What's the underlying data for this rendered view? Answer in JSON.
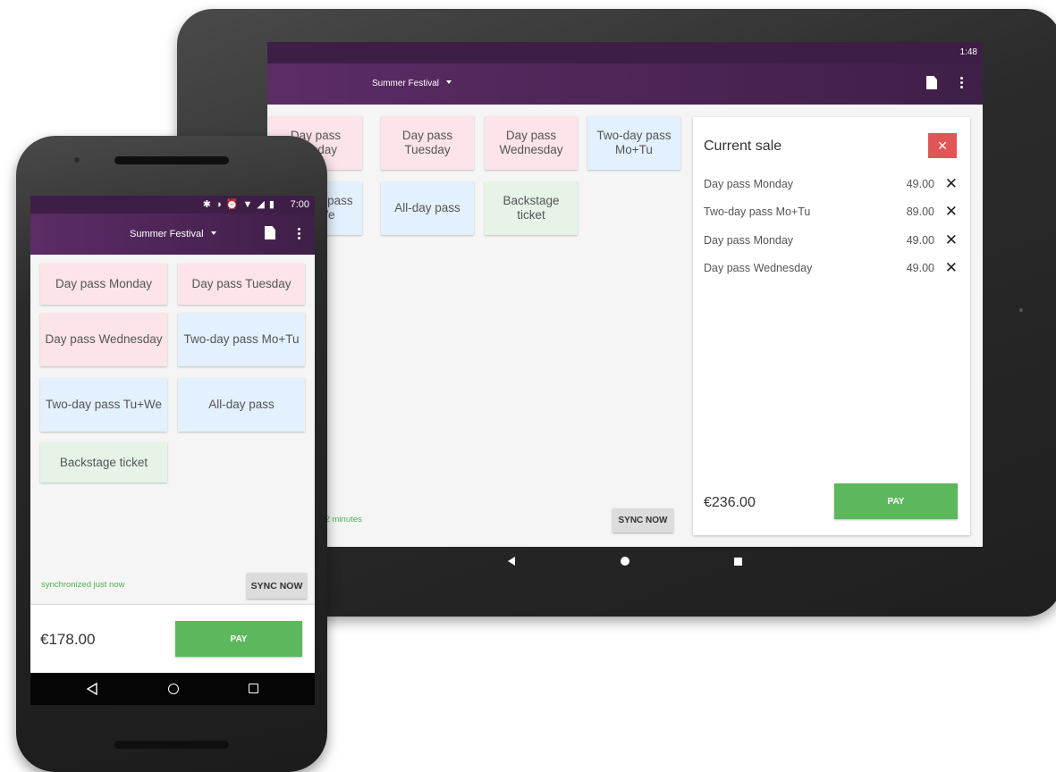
{
  "tablet": {
    "status": {
      "clock": "1:48"
    },
    "appbar": {
      "title": "Summer Festival"
    },
    "tiles": [
      {
        "label": "Day pass Monday",
        "color": "#fce4e8"
      },
      {
        "label": "Day pass Tuesday",
        "color": "#fce4e8"
      },
      {
        "label": "Day pass Wednesday",
        "color": "#fce4e8"
      },
      {
        "label": "Two-day pass Mo+Tu",
        "color": "#e3f0fd"
      },
      {
        "label": "Two-day pass Tu+We",
        "color": "#e3f0fd"
      },
      {
        "label": "All-day pass",
        "color": "#e3f0fd"
      },
      {
        "label": "Backstage ticket",
        "color": "#e6f4e8"
      }
    ],
    "sync_text": "synchronized 2 minutes",
    "sync_button": "SYNC NOW",
    "sale": {
      "title": "Current sale",
      "close_icon": "close-icon",
      "items": [
        {
          "name": "Day pass Monday",
          "price": "49.00"
        },
        {
          "name": "Two-day pass Mo+Tu",
          "price": "89.00"
        },
        {
          "name": "Day pass Monday",
          "price": "49.00"
        },
        {
          "name": "Day pass Wednesday",
          "price": "49.00"
        }
      ],
      "remove_symbol": "✕",
      "total": "€236.00",
      "pay_label": "PAY"
    }
  },
  "phone": {
    "status": {
      "clock": "7:00",
      "icons": "✱ ◑ ⏰ ▼ ◢ ▮"
    },
    "appbar": {
      "title": "Summer Festival"
    },
    "tiles": [
      {
        "label": "Day pass Monday",
        "color": "#fce4e8"
      },
      {
        "label": "Day pass Tuesday",
        "color": "#fce4e8"
      },
      {
        "label": "Day pass Wednesday",
        "color": "#fce4e8"
      },
      {
        "label": "Two-day pass Mo+Tu",
        "color": "#e3f0fd"
      },
      {
        "label": "Two-day pass Tu+We",
        "color": "#e3f0fd"
      },
      {
        "label": "All-day pass",
        "color": "#e3f0fd"
      },
      {
        "label": "Backstage ticket",
        "color": "#e6f4e8"
      }
    ],
    "sync_text": "synchronized just now",
    "sync_button": "SYNC NOW",
    "total": "€178.00",
    "pay_label": "PAY"
  },
  "colors": {
    "appbar": "#4e2557",
    "pay": "#5cb85c",
    "close": "#e05555",
    "sync_text": "#4caf50"
  }
}
